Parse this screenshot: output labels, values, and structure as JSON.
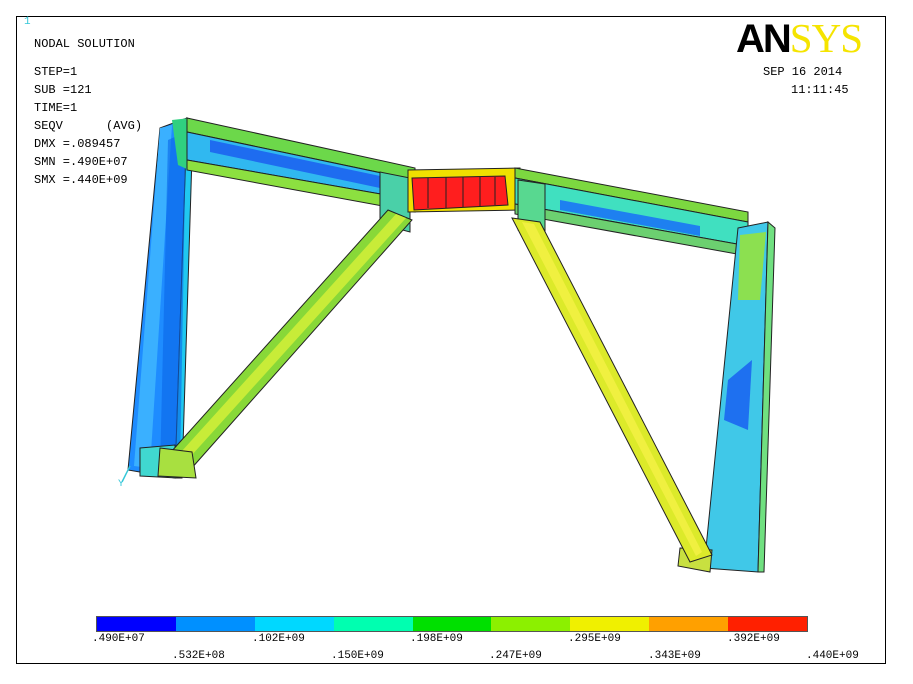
{
  "window_number": "1",
  "header": {
    "title": "NODAL SOLUTION",
    "lines": [
      "STEP=1",
      "SUB =121",
      "TIME=1",
      "SEQV      (AVG)",
      "DMX =.089457",
      "SMN =.490E+07",
      "SMX =.440E+09"
    ],
    "date": "SEP 16 2014",
    "time": "11:11:45"
  },
  "logo": {
    "part1": "AN",
    "part2": "SYS"
  },
  "triad_label": "Y",
  "legend": {
    "colors": [
      "#0000ff",
      "#0090ff",
      "#00d8ff",
      "#00ffb0",
      "#00e000",
      "#8cf000",
      "#f0f000",
      "#ffa000",
      "#ff2000"
    ],
    "labels_top": [
      ".490E+07",
      ".102E+09",
      ".198E+09",
      ".295E+09",
      ".392E+09"
    ],
    "labels_bottom": [
      ".532E+08",
      ".150E+09",
      ".247E+09",
      ".343E+09",
      ".440E+09"
    ]
  }
}
